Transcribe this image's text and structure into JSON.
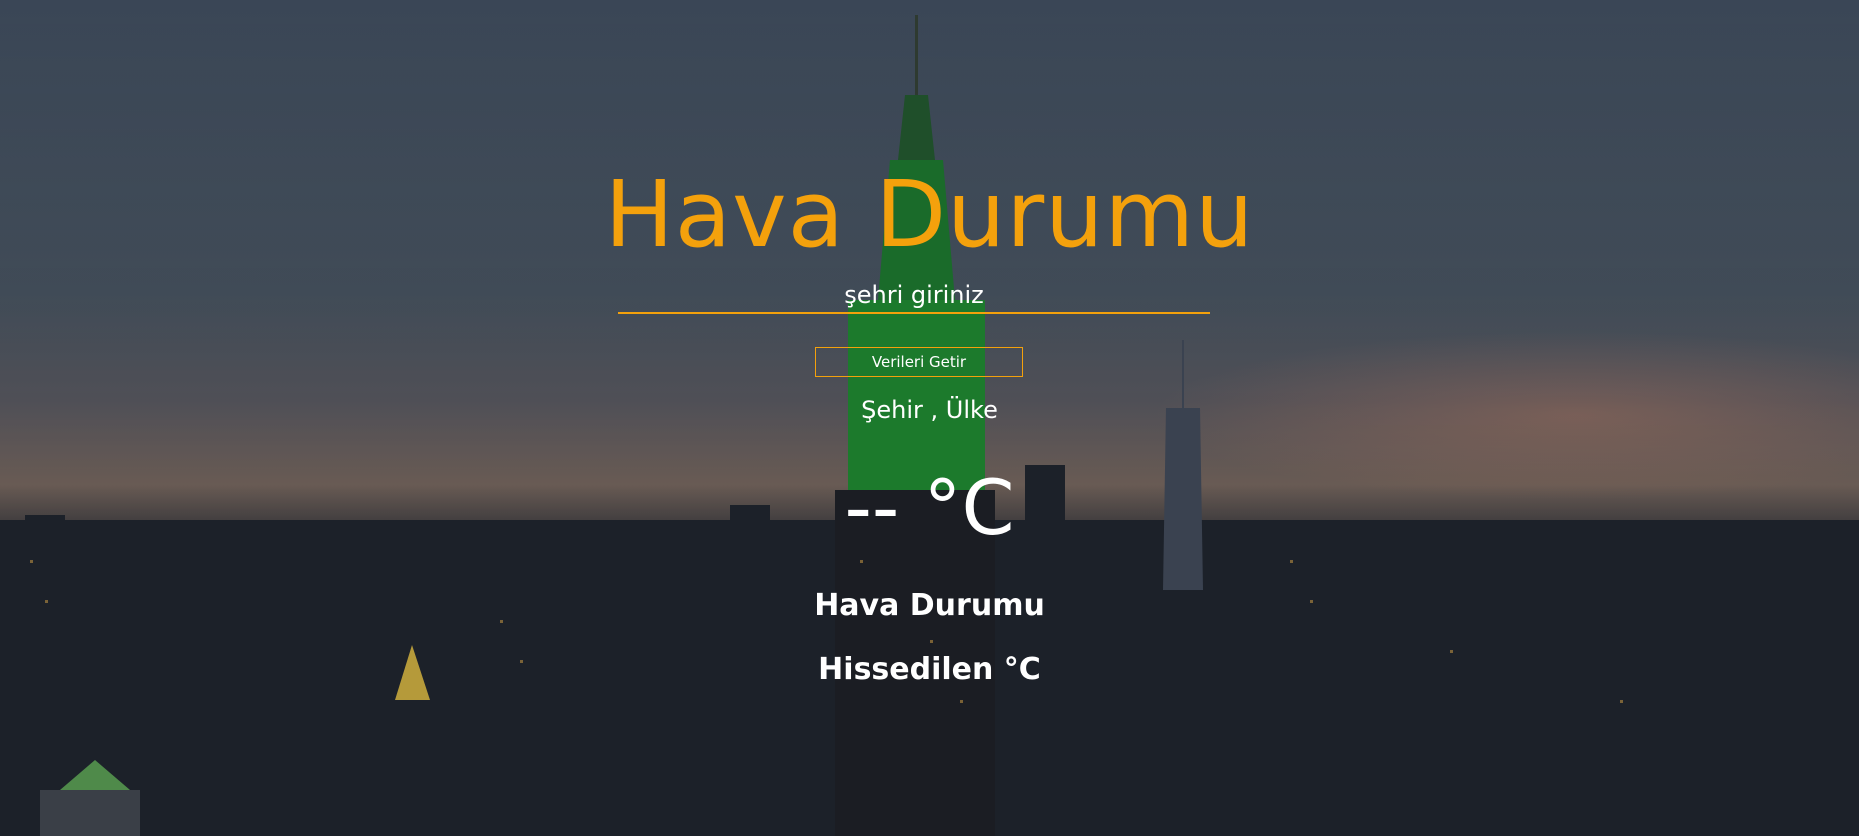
{
  "app": {
    "title": "Hava Durumu"
  },
  "search": {
    "placeholder": "şehri giriniz",
    "value": ""
  },
  "actions": {
    "fetch_label": "Verileri Getir"
  },
  "weather": {
    "location": "Şehir , Ülke",
    "temperature": "-- °C",
    "condition": "Hava Durumu",
    "feels_like": "Hissedilen °C"
  },
  "colors": {
    "accent": "#f4a10c",
    "text": "#ffffff"
  }
}
